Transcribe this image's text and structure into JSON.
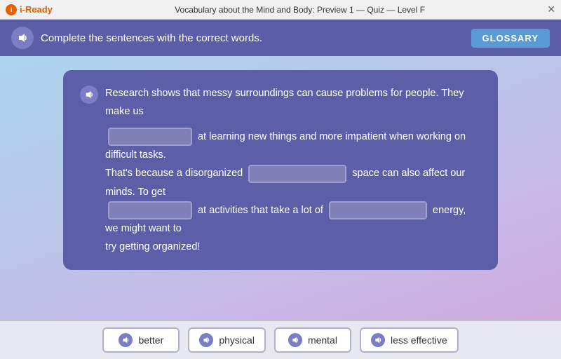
{
  "titleBar": {
    "logo": "i-Ready",
    "title": "Vocabulary about the Mind and Body: Preview 1 — Quiz — Level F",
    "closeLabel": "✕"
  },
  "header": {
    "instruction": "Complete the sentences with the correct words.",
    "glossaryLabel": "GLOSSARY"
  },
  "passage": {
    "line1": "Research shows that messy surroundings can cause problems for people. They make us",
    "line2": "at learning new things and more impatient when working on difficult tasks.",
    "line3": "That's because a disorganized",
    "line3b": "space can also affect our minds. To get",
    "line4": "at activities that take a lot of",
    "line4b": "energy, we might want to",
    "line5": "try getting organized!"
  },
  "wordBank": {
    "words": [
      {
        "id": "better",
        "label": "better"
      },
      {
        "id": "physical",
        "label": "physical"
      },
      {
        "id": "mental",
        "label": "mental"
      },
      {
        "id": "less-effective",
        "label": "less effective"
      }
    ]
  }
}
